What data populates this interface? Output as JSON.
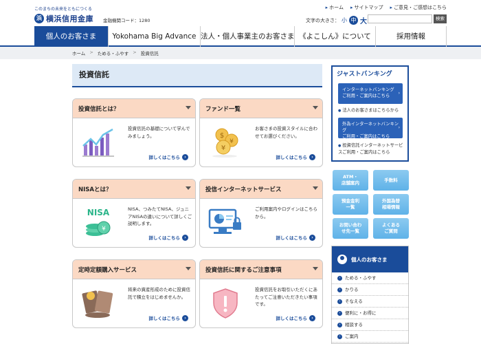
{
  "header": {
    "tagline": "このまちの未来をともにつくる",
    "logo_name": "横浜信用金庫",
    "bank_code": "金融機関コード：1280",
    "util_links": [
      "ホーム",
      "サイトマップ",
      "ご意見・ご感想はこちら"
    ],
    "font_size_label": "文字の大きさ：",
    "font_small": "小",
    "font_mid": "中",
    "font_large": "大",
    "search_placeholder": "",
    "search_button": "検索"
  },
  "nav": {
    "items": [
      "個人のお客さま",
      "Yokohama Big Advance",
      "法人・個人事業主のお客さま",
      "《よこしん》について",
      "採用情報"
    ]
  },
  "breadcrumb": [
    "ホーム",
    "ためる・ふやす",
    "投資信託"
  ],
  "main": {
    "title": "投資信託",
    "cards": [
      {
        "title": "投資信託とは？",
        "desc": "投資信託の基礎について学んでみましょう。",
        "more": "詳しくはこちら"
      },
      {
        "title": "ファンド一覧",
        "desc": "お客さまの投資スタイルに合わせてお選びください。",
        "more": "詳しくはこちら"
      },
      {
        "title": "NISAとは？",
        "desc": "NISA、つみたてNISA、ジュニアNISAの違いについて詳しくご説明します。",
        "more": "詳しくはこちら"
      },
      {
        "title": "投信インターネットサービス",
        "desc": "ご利用案内やログインはこちらから。",
        "more": "詳しくはこちら"
      },
      {
        "title": "定時定額購入サービス",
        "desc": "将来の資産形成のために投資信託で積立をはじめませんか。",
        "more": "詳しくはこちら"
      },
      {
        "title": "投資信託に関するご注意事項",
        "desc": "投資信託をお取引いただくにあたってご注意いただきたい事項です。",
        "more": "詳しくはこちら"
      }
    ],
    "nisa_label": "NISA"
  },
  "sidebar": {
    "jb_title": "ジャストバンキング",
    "jb_btn1_line1": "インターネットバンキング",
    "jb_btn1_line2": "ご利用・ご案内はこちら",
    "jb_link1": "法人のお客さまはこちらから",
    "jb_btn2_line1": "外為インターネットバンキング",
    "jb_btn2_line2": "ご利用・ご案内はこちら",
    "jb_link2": "投資信託インターネットサービスご利用・ご案内はこちら",
    "quick": [
      {
        "l1": "ATM・",
        "l2": "店舗案内"
      },
      {
        "l1": "手数料",
        "l2": ""
      },
      {
        "l1": "預金金利",
        "l2": "一覧"
      },
      {
        "l1": "外国為替",
        "l2": "相場情報"
      },
      {
        "l1": "お問い合わ",
        "l2": "せ先一覧"
      },
      {
        "l1": "よくある",
        "l2": "ご質問"
      }
    ],
    "personal_title": "個人のお客さま",
    "personal_items": [
      "ためる・ふやす",
      "かりる",
      "そなえる",
      "便利に・お得に",
      "相談する",
      "ご案内"
    ]
  },
  "colors": {
    "brand": "#1a4c9a",
    "card_header": "#fbd9c4",
    "quick_button": "#5fb2e8"
  }
}
